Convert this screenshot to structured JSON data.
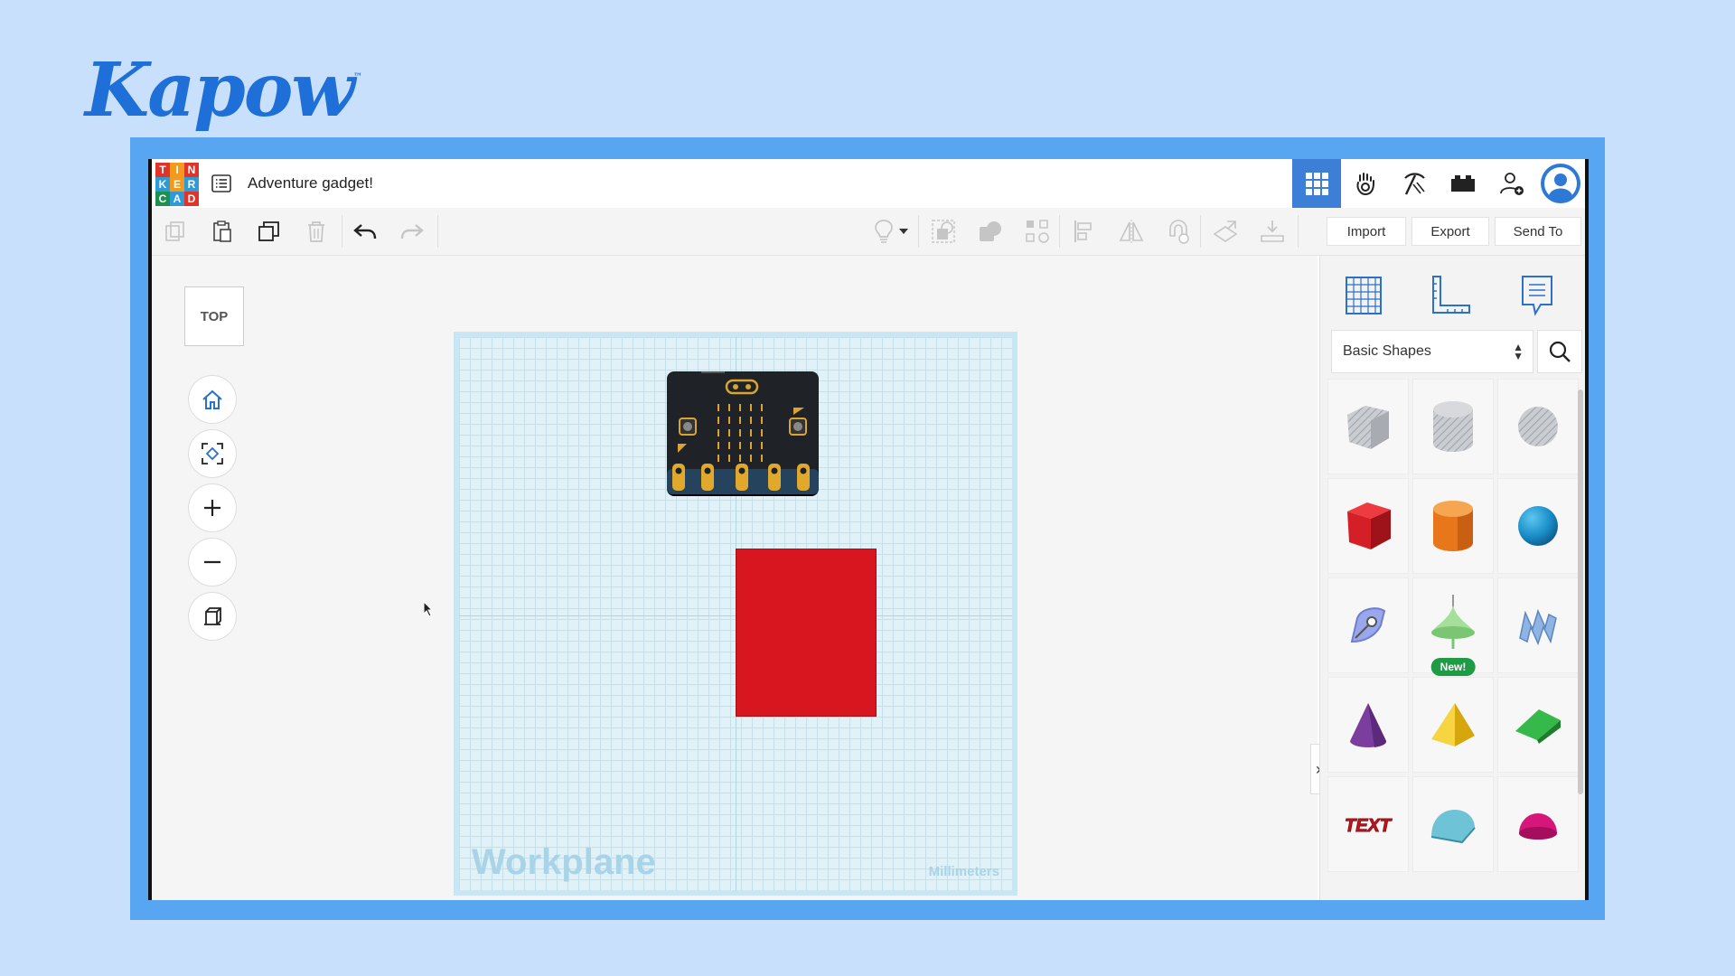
{
  "brand": {
    "name": "Kapow",
    "tm": "™"
  },
  "header": {
    "logo_letters": [
      "T",
      "I",
      "N",
      "K",
      "E",
      "R",
      "C",
      "A",
      "D"
    ],
    "logo_colors": [
      "#e0342b",
      "#f29a1e",
      "#e0342b",
      "#2e9bd6",
      "#f29a1e",
      "#2e9bd6",
      "#1d8f4e",
      "#2e9bd6",
      "#e0342b"
    ],
    "design_title": "Adventure gadget!",
    "icons": [
      "grid-view-icon",
      "tinker-hand-icon",
      "pickaxe-icon",
      "brick-icon",
      "add-user-icon",
      "user-avatar-icon"
    ]
  },
  "toolbar": {
    "icons": [
      "copy-icon",
      "paste-icon",
      "duplicate-icon",
      "delete-icon",
      "undo-icon",
      "redo-icon",
      "bulb-icon",
      "bulb-dropdown-icon",
      "group-icon",
      "solid-hole-icon",
      "align-icon",
      "distribute-icon",
      "mirror-icon",
      "magnet-icon",
      "workplane-tool-icon",
      "ruler-drop-icon"
    ],
    "import_label": "Import",
    "export_label": "Export",
    "send_label": "Send To"
  },
  "viewport": {
    "view_cube_label": "TOP",
    "nav": [
      "home-icon",
      "fit-view-icon",
      "zoom-in-icon",
      "zoom-out-icon",
      "perspective-icon"
    ],
    "workplane_label": "Workplane",
    "units_label": "Millimeters"
  },
  "panel": {
    "tools": [
      "workplane-icon",
      "ruler-icon",
      "notes-icon"
    ],
    "category": "Basic Shapes",
    "new_badge": "New!",
    "shapes": [
      {
        "name": "box-hole",
        "color": "#b9bcc2"
      },
      {
        "name": "cylinder-hole",
        "color": "#b9bcc2"
      },
      {
        "name": "sphere-hole",
        "color": "#b9bcc2"
      },
      {
        "name": "box",
        "color": "#d51f26"
      },
      {
        "name": "cylinder",
        "color": "#e8761b"
      },
      {
        "name": "sphere",
        "color": "#1b8fc9"
      },
      {
        "name": "scribble",
        "color": "#8f9ee6"
      },
      {
        "name": "shape-generator",
        "color": "#8ed48a"
      },
      {
        "name": "text-shape-blue",
        "color": "#8fb3e3"
      },
      {
        "name": "cone",
        "color": "#7b3d9e"
      },
      {
        "name": "pyramid",
        "color": "#f0c419"
      },
      {
        "name": "roof",
        "color": "#27a33a"
      },
      {
        "name": "text",
        "color": "#c3161d"
      },
      {
        "name": "half-cylinder",
        "color": "#5fb6cc"
      },
      {
        "name": "half-sphere",
        "color": "#d6167a"
      }
    ]
  }
}
